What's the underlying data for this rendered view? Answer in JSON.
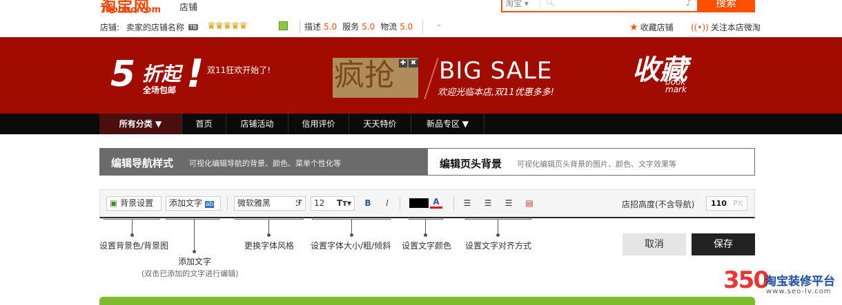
{
  "header": {
    "logo_cn": "淘宝网",
    "logo_en": "Taobao.com",
    "shop_label": "店铺",
    "search": {
      "type_label": "淘宝",
      "button_label": "搜索"
    }
  },
  "shop_bar": {
    "label": "店铺:",
    "name": "卖家的店铺名称",
    "badge": "TB",
    "crowns": "♛♛♛♛♛",
    "ratings": [
      {
        "label": "描述",
        "value": "5.0"
      },
      {
        "label": "服务",
        "value": "5.0"
      },
      {
        "label": "物流",
        "value": "5.0"
      }
    ],
    "favorite_label": "收藏店铺",
    "follow_label": "关注本店微淘"
  },
  "banner": {
    "number": "5",
    "discount": "折起",
    "free_shipping": "全场包邮",
    "bang": "!",
    "subtitle": "双11狂欢开始了!",
    "crazy": "疯抢",
    "big_sale": "BIG SALE",
    "sale_sub": "欢迎光临本店,双11优惠多多!",
    "collect": "收藏",
    "bookmark_1": "book",
    "bookmark_2": "mark"
  },
  "nav": {
    "items": [
      "所有分类",
      "首页",
      "店铺活动",
      "信用评价",
      "天天特价",
      "新品专区"
    ]
  },
  "tabs": [
    {
      "title": "编辑导航样式",
      "desc": "可视化编辑导航的背景、颜色、菜单个性化等"
    },
    {
      "title": "编辑页头背景",
      "desc": "可视化编辑页头背景的图片、颜色、文字效果等"
    }
  ],
  "toolbar": {
    "bg_setting": "背景设置",
    "add_text": "添加文字",
    "font": "微软雅黑",
    "size": "12",
    "bold": "B",
    "italic": "I",
    "height_label": "店招高度(不含导航)",
    "height_value": "110",
    "height_unit": "PX"
  },
  "callouts": {
    "bg": "设置背景色/背景图",
    "add_text": "添加文字",
    "add_text_note": "(双击已添加的文字进行编辑)",
    "font": "更换字体风格",
    "size": "设置字体大小/粗/倾斜",
    "color": "设置文字颜色",
    "align": "设置文字对齐方式"
  },
  "actions": {
    "cancel": "取消",
    "save": "保存"
  },
  "watermark": {
    "num": "350",
    "text": "淘宝装修平台",
    "url": "www.seo-lv.com"
  },
  "colors": {
    "accent": "#ff5000",
    "banner": "#a20c00",
    "nav": "#0b0b0b",
    "save": "#222222"
  }
}
